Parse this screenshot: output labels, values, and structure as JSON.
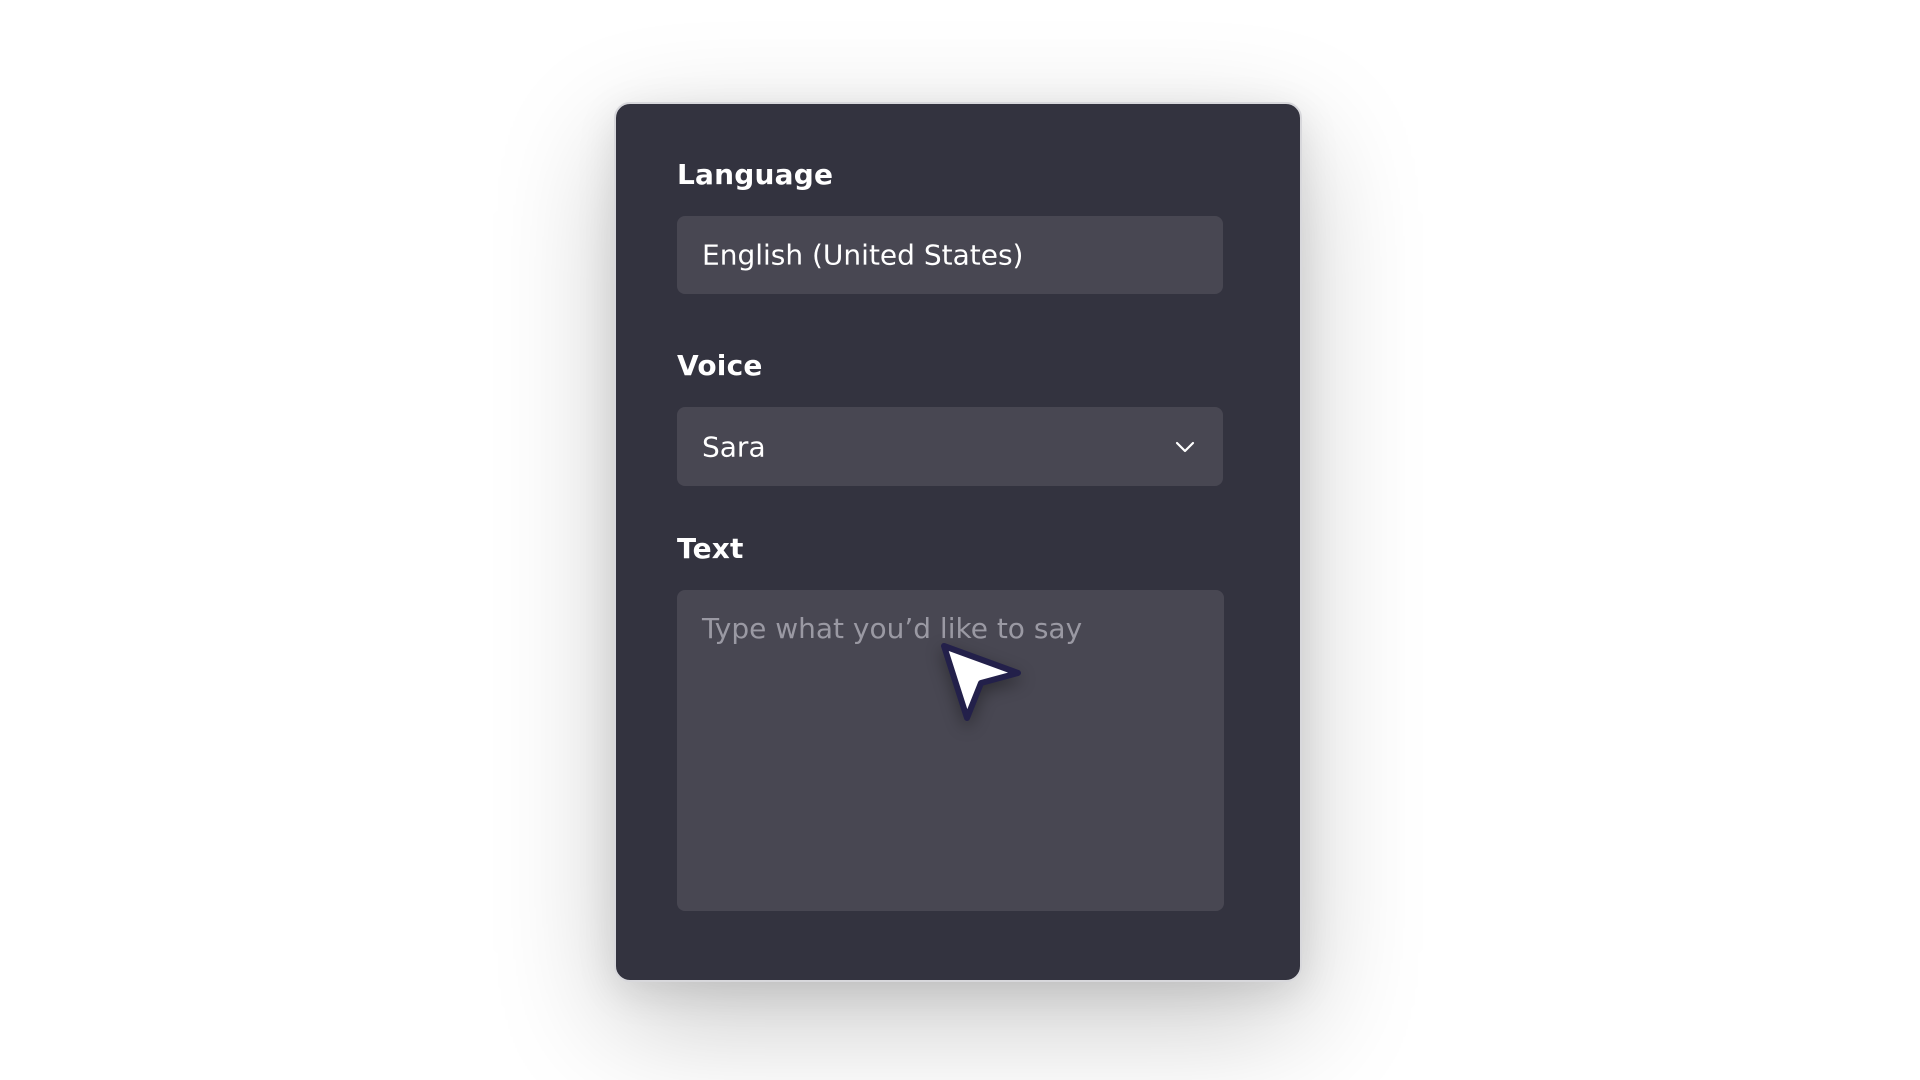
{
  "form": {
    "language": {
      "label": "Language",
      "value": "English (United States)"
    },
    "voice": {
      "label": "Voice",
      "value": "Sara",
      "icon": "chevron-down-icon"
    },
    "text": {
      "label": "Text",
      "placeholder": "Type what you’d like to say"
    }
  },
  "colors": {
    "panel": "#33333f",
    "field": "#484752",
    "text": "#ffffff",
    "placeholder": "#9a99a3",
    "cursor_fill": "#ffffff",
    "cursor_outline": "#23204a"
  },
  "overlay": {
    "cursor_icon": "mouse-pointer-icon"
  }
}
